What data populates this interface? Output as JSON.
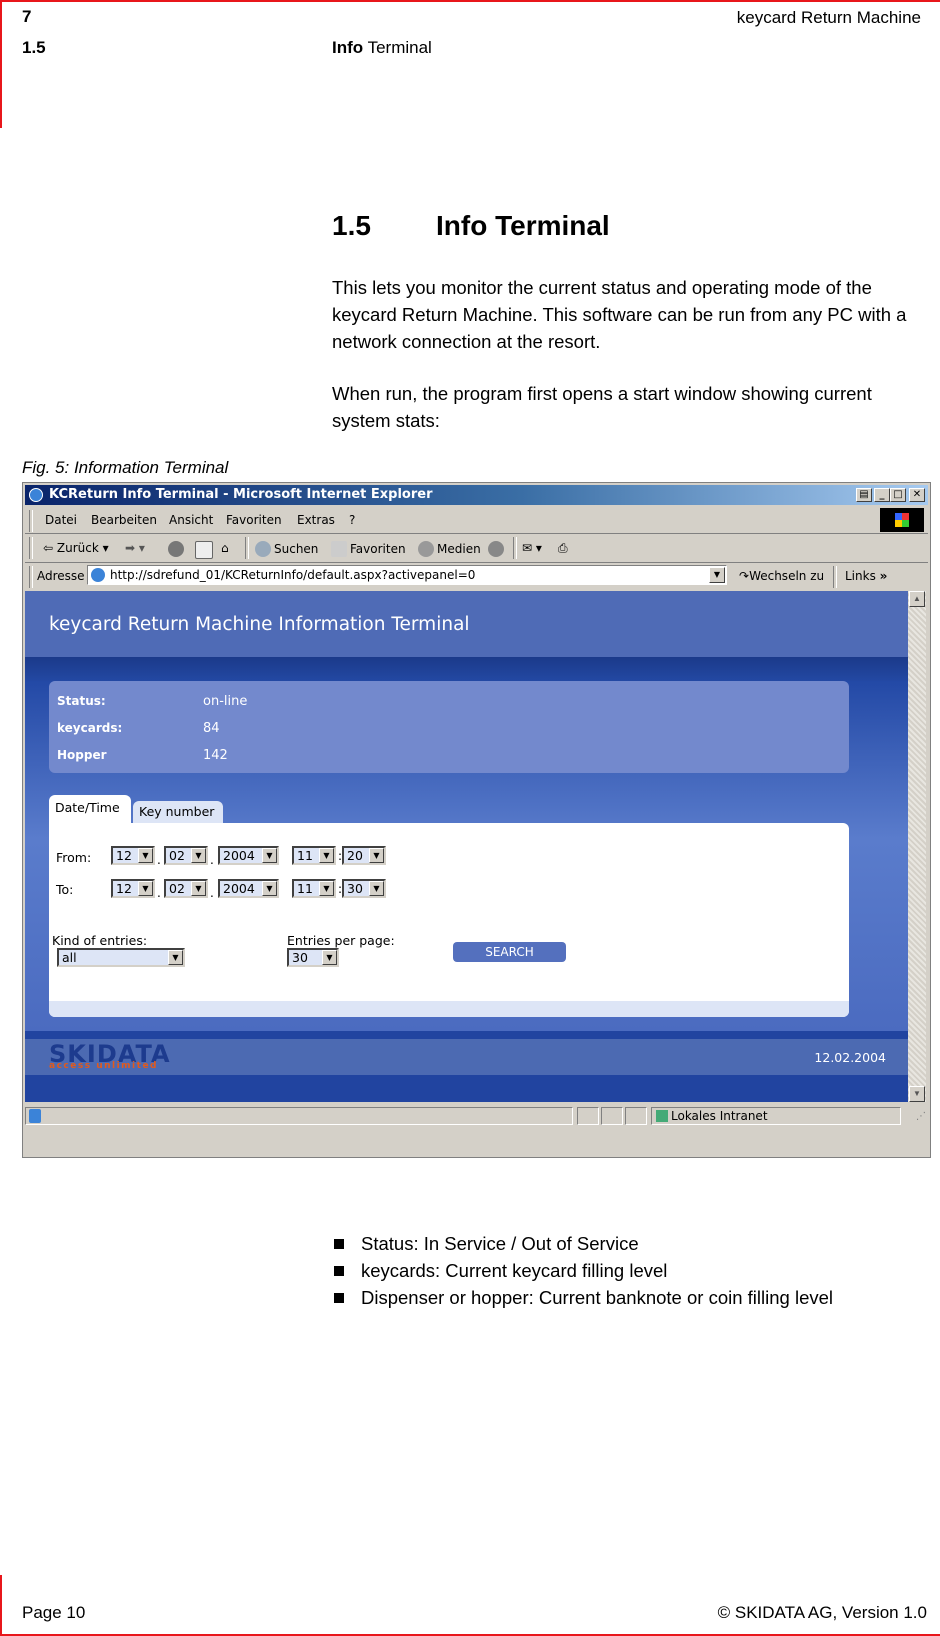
{
  "document": {
    "header": {
      "chapter_number": "7",
      "manual_title": "keycard Return Machine",
      "section_number": "1.5",
      "section_title_bold": "Info",
      "section_title_rest": " Terminal"
    },
    "heading": {
      "number": "1.5",
      "title": "Info Terminal"
    },
    "paragraphs": [
      "This lets you monitor the current status and operating mode of the keycard Return Machine. This software can be run from any PC with a network connection at the resort.",
      "When run, the program first opens a start window showing current system stats:"
    ],
    "figure_caption": "Fig. 5: Information Terminal",
    "bullets": [
      "Status: In Service / Out of Service",
      "keycards: Current keycard filling level",
      "Dispenser or hopper: Current banknote or coin filling level"
    ],
    "footer": {
      "page": "Page 10",
      "copyright": "© SKIDATA AG, Version 1.0"
    },
    "accent_color": "#e8161b"
  },
  "browser": {
    "window_title": "KCReturn Info Terminal - Microsoft Internet Explorer",
    "window_buttons": [
      "print-icon",
      "minimize",
      "maximize",
      "close"
    ],
    "menu": [
      {
        "label": "Datei",
        "access_key": "D"
      },
      {
        "label": "Bearbeiten",
        "access_key": "B"
      },
      {
        "label": "Ansicht",
        "access_key": "A"
      },
      {
        "label": "Favoriten",
        "access_key": "F"
      },
      {
        "label": "Extras",
        "access_key": "x"
      },
      {
        "label": "?",
        "access_key": "?"
      }
    ],
    "toolbar": {
      "back": "Zurück",
      "search": "Suchen",
      "favorites": "Favoriten",
      "media": "Medien"
    },
    "address": {
      "label": "Adresse",
      "url": "http://sdrefund_01/KCReturnInfo/default.aspx?activepanel=0",
      "go": "Wechseln zu",
      "links": "Links",
      "links_more": "»"
    },
    "status_bar": {
      "zone": "Lokales Intranet"
    }
  },
  "app": {
    "title": "keycard Return Machine Information Terminal",
    "status": [
      {
        "label": "Status:",
        "value": "on-line"
      },
      {
        "label": "keycards:",
        "value": "84"
      },
      {
        "label": "Hopper",
        "value": "142"
      }
    ],
    "tabs": [
      {
        "label": "Date/Time",
        "active": true
      },
      {
        "label": "Key number",
        "active": false
      }
    ],
    "form": {
      "from_label": "From:",
      "to_label": "To:",
      "from": {
        "day": "12",
        "month": "02",
        "year": "2004",
        "hour": "11",
        "minute": "20"
      },
      "to": {
        "day": "12",
        "month": "02",
        "year": "2004",
        "hour": "11",
        "minute": "30"
      },
      "date_sep": ".",
      "time_sep": ":",
      "kind_label": "Kind of entries:",
      "kind_value": "all",
      "per_page_label": "Entries per page:",
      "per_page_value": "30",
      "search_button": "SEARCH"
    },
    "footer": {
      "logo": "SKIDATA",
      "logo_tagline": "access unlimited",
      "date": "12.02.2004"
    }
  }
}
